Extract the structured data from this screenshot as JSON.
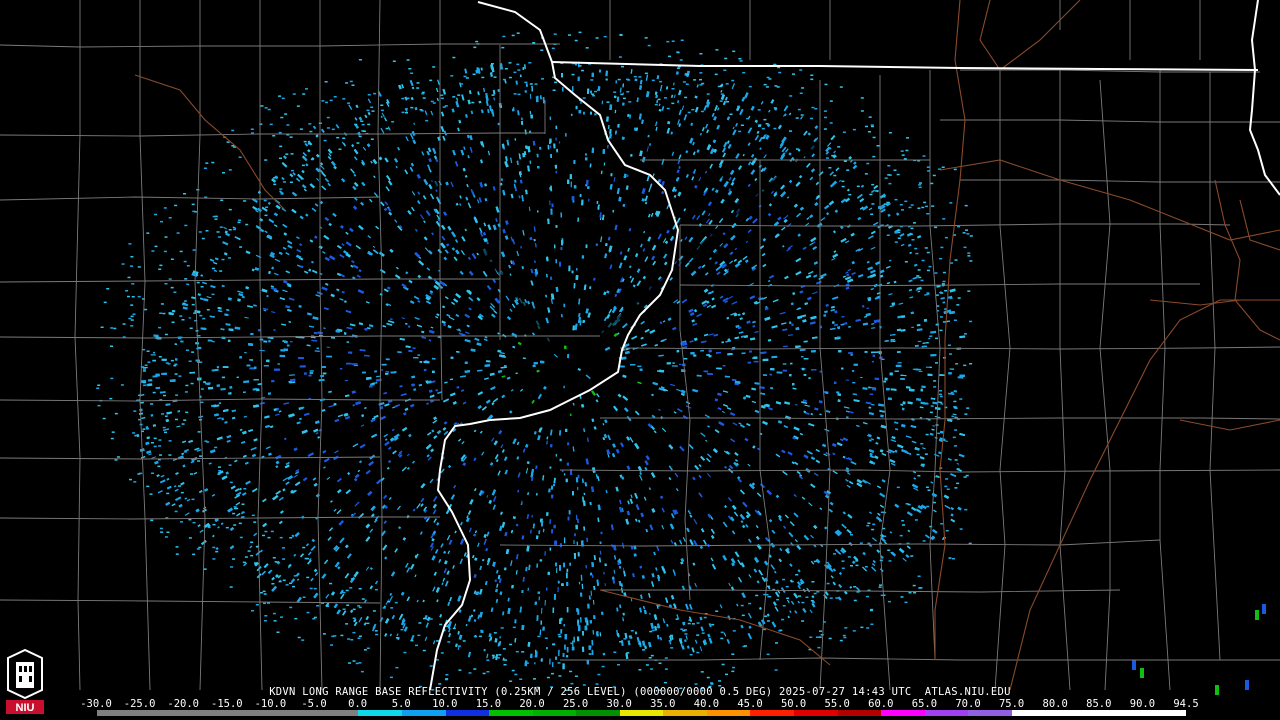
{
  "caption": "KDVN LONG RANGE BASE REFLECTIVITY (0.25KM / 256 LEVEL) (000000/0000 0.5 DEG) 2025-07-27 14:43 UTC  ATLAS.NIU.EDU",
  "scale": {
    "ticks": [
      "-30.0",
      "-25.0",
      "-20.0",
      "-15.0",
      "-10.0",
      "-5.0",
      "0.0",
      "5.0",
      "10.0",
      "15.0",
      "20.0",
      "25.0",
      "30.0",
      "35.0",
      "40.0",
      "45.0",
      "50.0",
      "55.0",
      "60.0",
      "65.0",
      "70.0",
      "75.0",
      "80.0",
      "85.0",
      "90.0",
      "94.5"
    ],
    "colors": [
      "#7f7f7f",
      "#7f7f7f",
      "#7f7f7f",
      "#7f7f7f",
      "#7f7f7f",
      "#7f7f7f",
      "#10d8e8",
      "#10a0f0",
      "#1030e0",
      "#00c000",
      "#00b000",
      "#009000",
      "#e8e800",
      "#e8b000",
      "#ff9000",
      "#ff2000",
      "#e00000",
      "#b00000",
      "#ff00ff",
      "#a040f0",
      "#9060e0",
      "#ffffff",
      "#ffffff",
      "#ffffff",
      "#ffffff"
    ]
  },
  "logo": {
    "text": "NIU",
    "name": "niu-logo"
  },
  "radar": {
    "site": "KDVN",
    "colors": {
      "light": "#2ec4ec",
      "mid": "#1aa6e8",
      "dark": "#1a5ae0",
      "green": "#10c010"
    }
  },
  "map_colors": {
    "background": "#000000",
    "county": "#7a7a7a",
    "state": "#ffffff",
    "road": "#8b4a2a"
  }
}
